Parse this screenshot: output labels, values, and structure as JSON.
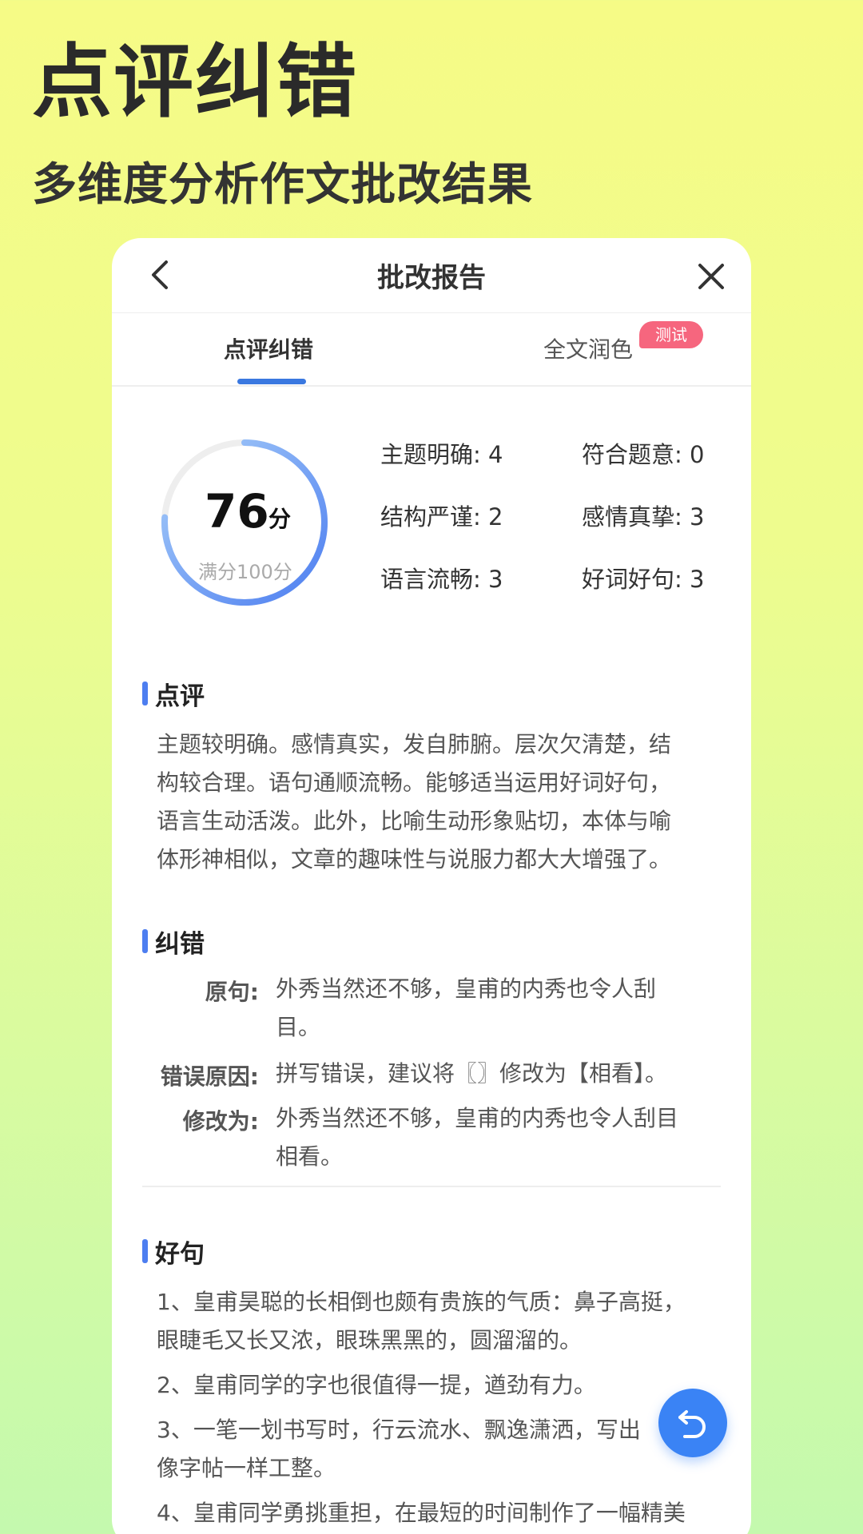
{
  "hero": {
    "title": "点评纠错",
    "subtitle": "多维度分析作文批改结果"
  },
  "topbar": {
    "title": "批改报告",
    "back_icon": "chevron-left-icon",
    "close_icon": "close-icon"
  },
  "tabs": [
    {
      "label": "点评纠错",
      "active": true
    },
    {
      "label": "全文润色",
      "active": false,
      "badge": "测试"
    }
  ],
  "score": {
    "value": "76",
    "unit": "分",
    "full": "满分100分",
    "progress": 0.76
  },
  "metrics": [
    {
      "text": "主题明确: 4"
    },
    {
      "text": "符合题意: 0"
    },
    {
      "text": "结构严谨: 2"
    },
    {
      "text": "感情真挚: 3"
    },
    {
      "text": "语言流畅: 3"
    },
    {
      "text": "好词好句: 3"
    }
  ],
  "comment": {
    "heading": "点评",
    "lines": [
      "主题较明确。感情真实，发自肺腑。层次欠清楚，结",
      "构较合理。语句通顺流畅。能够适当运用好词好句，",
      "语言生动活泼。此外，比喻生动形象贴切，本体与喻",
      "体形神相似，文章的趣味性与说服力都大大增强了。"
    ]
  },
  "correction": {
    "heading": "纠错",
    "original_label": "原句:",
    "original_lines": [
      "外秀当然还不够，皇甫的内秀也令人刮",
      "目。"
    ],
    "reason_label": "错误原因:",
    "reason_text": "拼写错误，建议将〖〗修改为【相看】。",
    "fix_label": "修改为:",
    "fix_lines": [
      "外秀当然还不够，皇甫的内秀也令人刮目",
      "相看。"
    ]
  },
  "good_sentences": {
    "heading": "好句",
    "lines": [
      "1、皇甫昊聪的长相倒也颇有贵族的气质：鼻子高挺，",
      "眼睫毛又长又浓，眼珠黑黑的，圆溜溜的。",
      "2、皇甫同学的字也很值得一提，遒劲有力。",
      "3、一笔一划书写时，行云流水、飘逸潇洒，写出",
      "像字帖一样工整。",
      "4、皇甫同学勇挑重担，在最短的时间制作了一幅精美"
    ]
  },
  "colors": {
    "accent": "#3a78e0",
    "badge": "#f6667e",
    "ring_start": "#4d7ef0",
    "ring_end": "#9ec6f8",
    "ring_track": "#eeeeee"
  },
  "fab_icon": "undo-icon"
}
